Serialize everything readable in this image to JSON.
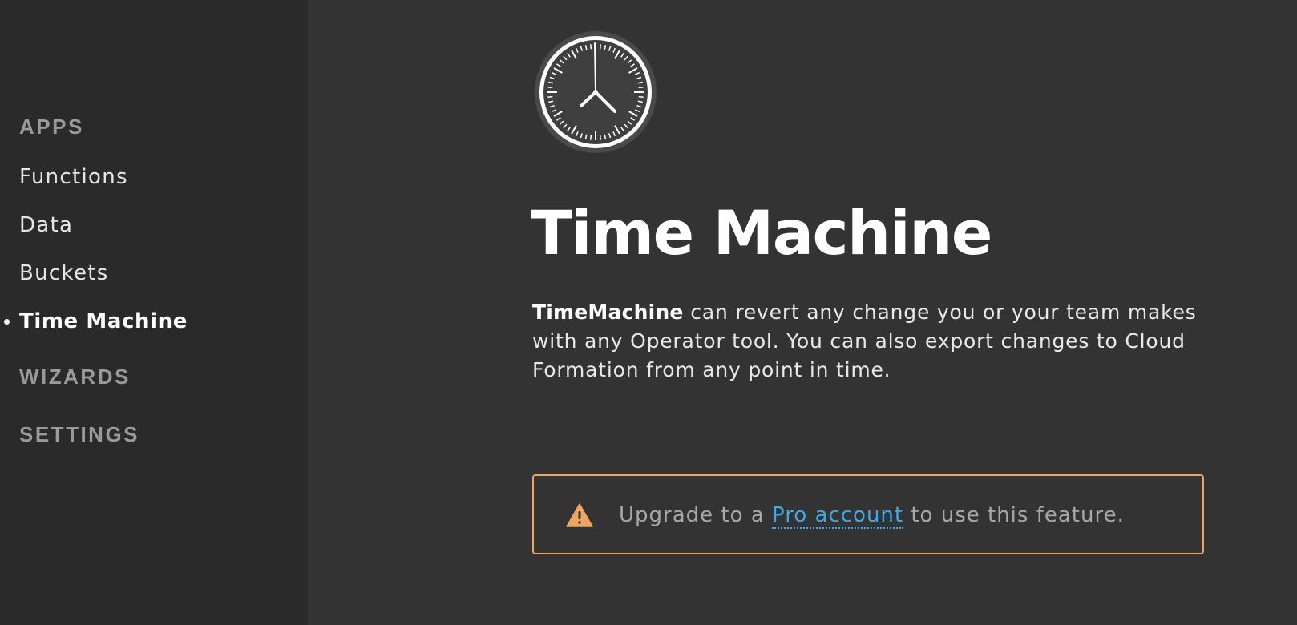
{
  "sidebar": {
    "apps_heading": "APPS",
    "items": [
      {
        "label": "Functions"
      },
      {
        "label": "Data"
      },
      {
        "label": "Buckets"
      },
      {
        "label": "Time Machine",
        "active": true
      }
    ],
    "wizards_heading": "WIZARDS",
    "settings_heading": "SETTINGS"
  },
  "main": {
    "icon": "clock-icon",
    "title": "Time Machine",
    "description": {
      "product_name": "TimeMachine",
      "body": " can revert any change you or your team makes with any Operator tool. You can also export changes to Cloud Formation from any point in time."
    },
    "notice": {
      "icon": "warning-icon",
      "prefix": "Upgrade to a ",
      "link_label": "Pro account",
      "suffix": " to use this feature."
    }
  },
  "colors": {
    "background": "#333333",
    "sidebar_background": "#2a2a2a",
    "accent_link": "#3fa9e8",
    "warning": "#f0a461"
  }
}
